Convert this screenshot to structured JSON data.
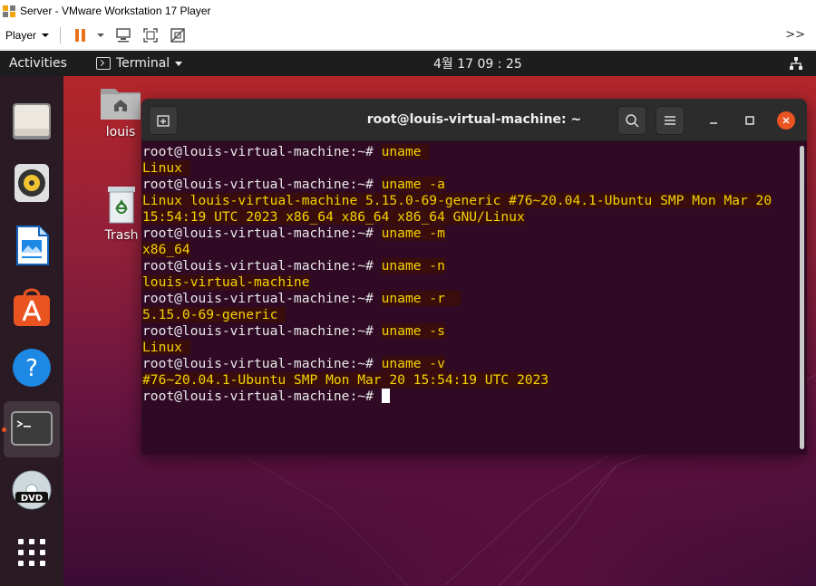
{
  "vmware": {
    "window_title": "Server - VMware Workstation 17 Player",
    "player_menu_label": "Player",
    "more_label": ">>"
  },
  "topbar": {
    "activities_label": "Activities",
    "app_menu_label": "Terminal",
    "clock": "4월 17  09 : 25"
  },
  "desktop": {
    "home_icon_label": "louis",
    "trash_icon_label": "Trash"
  },
  "dock": {
    "items": [
      "files-icon",
      "rhythmbox-icon",
      "libreoffice-writer-icon",
      "ubuntu-software-icon",
      "help-icon",
      "terminal-icon",
      "dvd-icon",
      "show-applications-icon"
    ],
    "active_item": "terminal-icon"
  },
  "terminal": {
    "title": "root@louis-virtual-machine: ~",
    "lines": [
      {
        "prompt": "root@louis-virtual-machine:~# ",
        "command": "uname "
      },
      {
        "output": "Linux "
      },
      {
        "prompt": "root@louis-virtual-machine:~# ",
        "command": "uname -a"
      },
      {
        "output": "Linux louis-virtual-machine 5.15.0-69-generic #76~20.04.1-Ubuntu SMP Mon Mar 20"
      },
      {
        "output": "15:54:19 UTC 2023 x86_64 x86_64 x86_64 GNU/Linux"
      },
      {
        "prompt": "root@louis-virtual-machine:~# ",
        "command": "uname -m"
      },
      {
        "output": "x86_64"
      },
      {
        "prompt": "root@louis-virtual-machine:~# ",
        "command": "uname -n"
      },
      {
        "output": "louis-virtual-machine"
      },
      {
        "prompt": "root@louis-virtual-machine:~# ",
        "command": "uname -r  "
      },
      {
        "output": "5.15.0-69-generic "
      },
      {
        "prompt": "root@louis-virtual-machine:~# ",
        "command": "uname -s"
      },
      {
        "output": "Linux "
      },
      {
        "prompt": "root@louis-virtual-machine:~# ",
        "command": "uname -v"
      },
      {
        "output": "#76~20.04.1-Ubuntu SMP Mon Mar 20 15:54:19 UTC 2023"
      },
      {
        "prompt": "root@louis-virtual-machine:~# ",
        "command": "",
        "cursor": true
      }
    ]
  },
  "colors": {
    "ubuntu_orange": "#e95420",
    "terminal_bg": "#300a24",
    "highlight_text": "#f5d300",
    "vmware_pause": "#e8731f"
  }
}
